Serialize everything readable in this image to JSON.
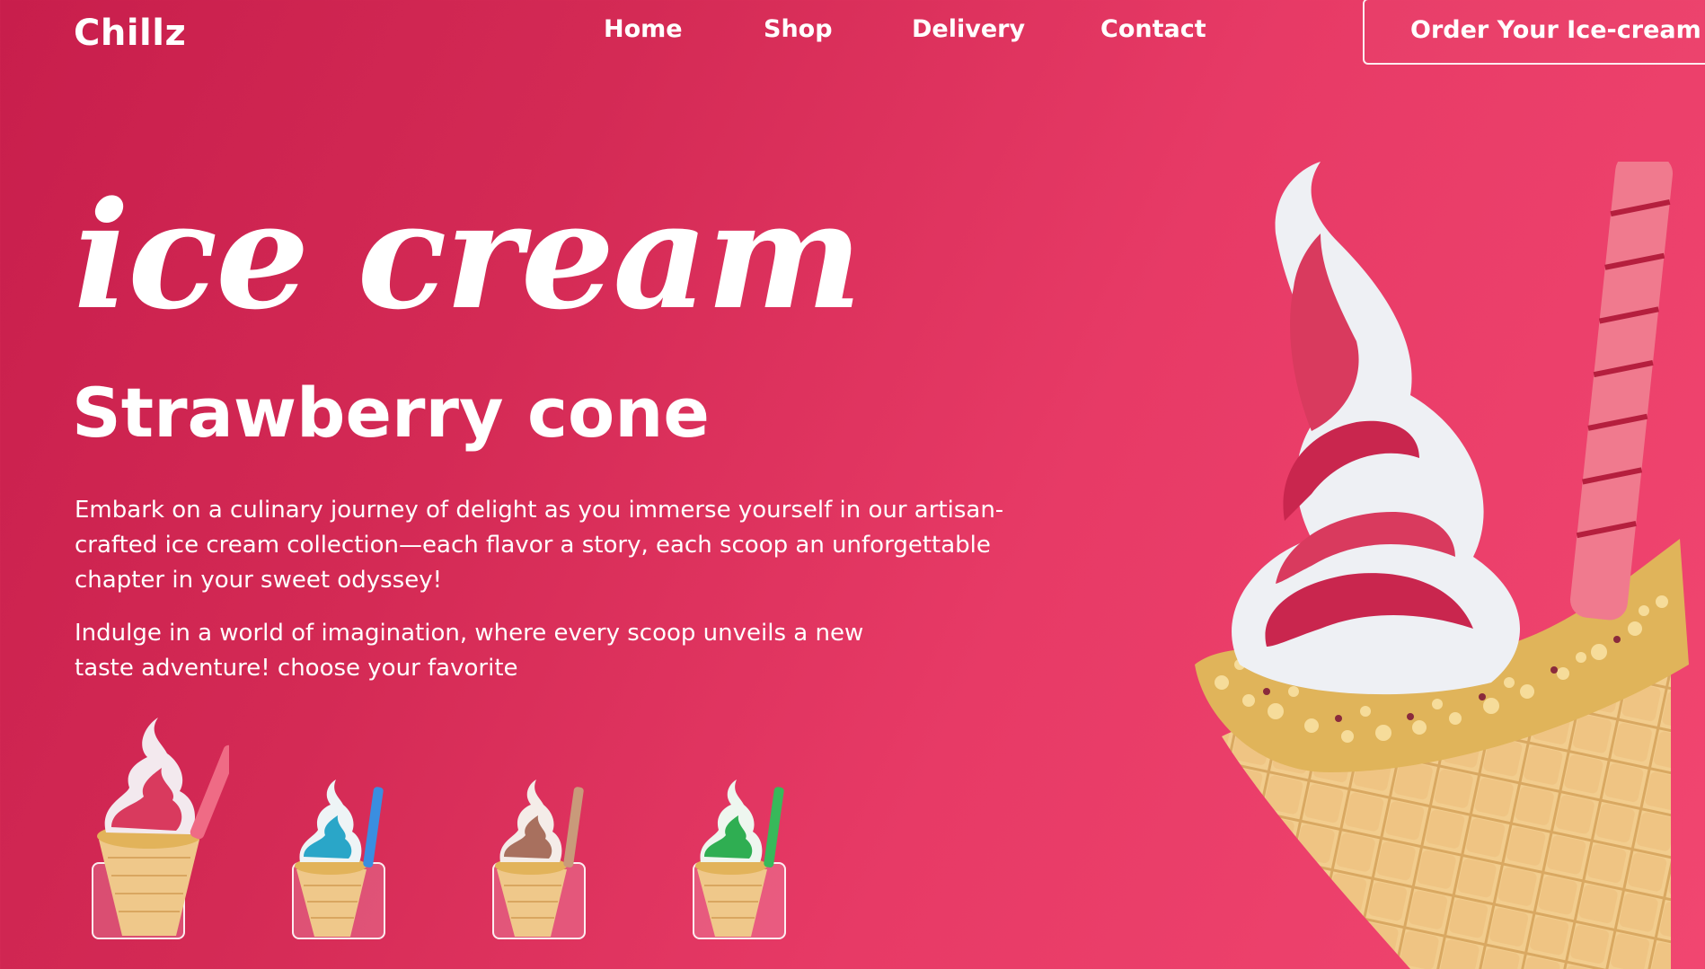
{
  "brand": {
    "name": "Chillz"
  },
  "nav": {
    "items": [
      {
        "label": "Home"
      },
      {
        "label": "Shop"
      },
      {
        "label": "Delivery"
      },
      {
        "label": "Contact"
      }
    ],
    "cta_label": "Order Your Ice-cream"
  },
  "hero": {
    "script_title": "ice cream",
    "subtitle": "Strawberry cone",
    "description_1": "Embark on a culinary journey of delight as you immerse yourself in our artisan-crafted ice cream collection—each flavor a story, each scoop an unforgettable chapter in your sweet odyssey!",
    "description_2": "Indulge in a world of imagination, where every scoop unveils a new taste adventure! choose your favorite"
  },
  "flavors": [
    {
      "name": "strawberry",
      "color": "#d93a5e",
      "stick": "#ef6b85"
    },
    {
      "name": "blue",
      "color": "#2aa6c8",
      "stick": "#3a8ee0"
    },
    {
      "name": "chocolate",
      "color": "#a8705e",
      "stick": "#c99a7a"
    },
    {
      "name": "mint",
      "color": "#2fae52",
      "stick": "#38b95a"
    }
  ],
  "colors": {
    "background_start": "#c81e4c",
    "background_end": "#f14670",
    "text": "#ffffff",
    "cone": "#efc88a",
    "nuts": "#e4b85a"
  }
}
